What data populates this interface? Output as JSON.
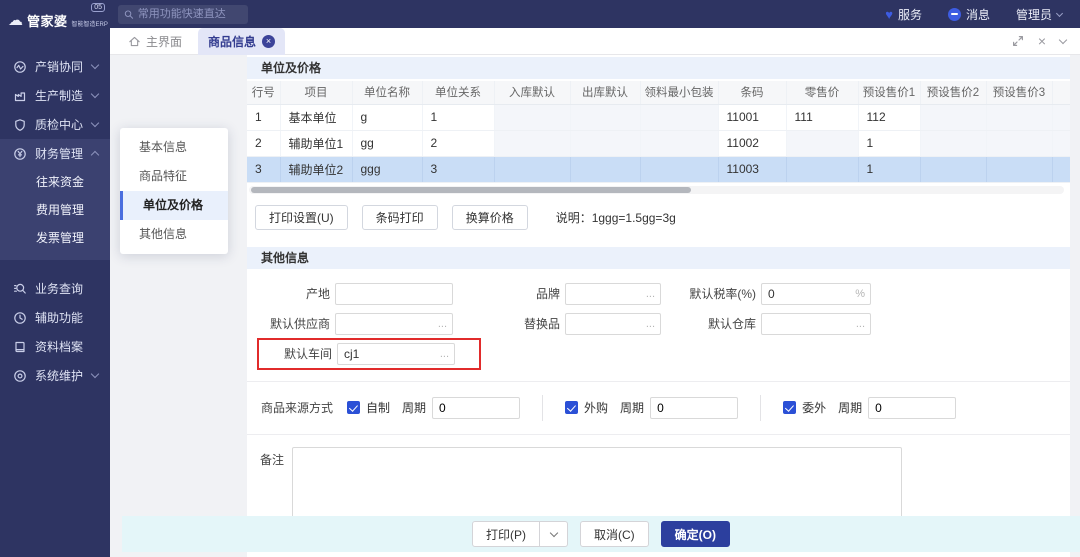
{
  "header": {
    "logo_title": "管家婆",
    "logo_sub": "智能智造ERP",
    "logo_badge": "05",
    "search_placeholder": "常用功能快速直达",
    "service": "服务",
    "message": "消息",
    "user": "管理员"
  },
  "tabs": {
    "home": "主界面",
    "product": "商品信息"
  },
  "sidebar": {
    "items": [
      {
        "label": "产销协同"
      },
      {
        "label": "生产制造"
      },
      {
        "label": "质检中心"
      },
      {
        "label": "财务管理"
      },
      {
        "label": "业务查询"
      },
      {
        "label": "辅助功能"
      },
      {
        "label": "资料档案"
      },
      {
        "label": "系统维护"
      }
    ],
    "finance_children": [
      {
        "label": "往来资金"
      },
      {
        "label": "费用管理"
      },
      {
        "label": "发票管理"
      }
    ]
  },
  "nav_card": {
    "items": [
      {
        "label": "基本信息"
      },
      {
        "label": "商品特征"
      },
      {
        "label": "单位及价格"
      },
      {
        "label": "其他信息"
      }
    ]
  },
  "unit_section": {
    "title": "单位及价格",
    "columns": [
      "行号",
      "项目",
      "单位名称",
      "单位关系",
      "入库默认",
      "出库默认",
      "领料最小包装",
      "条码",
      "零售价",
      "预设售价1",
      "预设售价2",
      "预设售价3"
    ],
    "rows": [
      {
        "cells": [
          "1",
          "基本单位",
          "g",
          "1",
          "",
          "",
          "",
          "11001",
          "111",
          "112",
          "",
          ""
        ]
      },
      {
        "cells": [
          "2",
          "辅助单位1",
          "gg",
          "2",
          "",
          "",
          "",
          "11002",
          "",
          "1",
          "",
          ""
        ]
      },
      {
        "cells": [
          "3",
          "辅助单位2",
          "ggg",
          "3",
          "",
          "",
          "",
          "11003",
          "",
          "1",
          "",
          ""
        ]
      }
    ],
    "buttons": {
      "print_setup": "打印设置(U)",
      "barcode_print": "条码打印",
      "convert_price": "换算价格"
    },
    "note": "说明：1ggg=1.5gg=3g"
  },
  "other_section": {
    "title": "其他信息",
    "fields": {
      "origin": {
        "label": "产地",
        "value": ""
      },
      "brand": {
        "label": "品牌",
        "value": "",
        "ellipsis": "..."
      },
      "tax": {
        "label": "默认税率(%)",
        "value": "0",
        "suffix": "%"
      },
      "supplier": {
        "label": "默认供应商",
        "value": "",
        "ellipsis": "..."
      },
      "substitute": {
        "label": "替换品",
        "value": "",
        "ellipsis": "..."
      },
      "warehouse": {
        "label": "默认仓库",
        "value": "",
        "ellipsis": "..."
      },
      "workshop": {
        "label": "默认车间",
        "value": "cj1",
        "ellipsis": "..."
      }
    }
  },
  "source_section": {
    "label": "商品来源方式",
    "options": [
      {
        "name": "自制",
        "cycle": "周期",
        "value": "0"
      },
      {
        "name": "外购",
        "cycle": "周期",
        "value": "0"
      },
      {
        "name": "委外",
        "cycle": "周期",
        "value": "0"
      }
    ]
  },
  "remark": {
    "label": "备注",
    "value": ""
  },
  "footer": {
    "print": "打印(P)",
    "cancel": "取消(C)",
    "ok": "确定(O)"
  },
  "colors": {
    "accent": "#2c3f9e",
    "sidebar": "#2e3462",
    "highlight_box": "#e12b2b",
    "selected_row": "#c9ddf6"
  }
}
